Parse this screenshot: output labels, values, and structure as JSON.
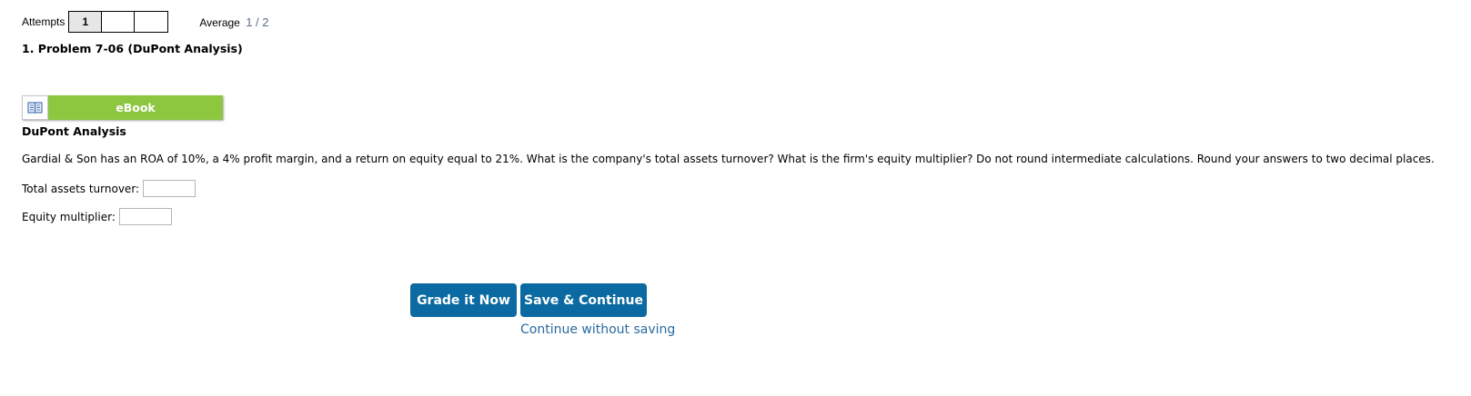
{
  "attempts": {
    "label": "Attempts",
    "boxes": [
      "1",
      "",
      ""
    ]
  },
  "average": {
    "label": "Average",
    "value": "1 / 2"
  },
  "problem": {
    "title": "1.  Problem 7-06 (DuPont Analysis)"
  },
  "ebook": {
    "label": "eBook",
    "icon": "book-icon"
  },
  "section": {
    "heading": "DuPont Analysis",
    "text": "Gardial & Son has an ROA of 10%, a 4% profit margin, and a return on equity equal to 21%. What is the company's total assets turnover? What is the firm's equity multiplier? Do not round intermediate calculations. Round your answers to two decimal places."
  },
  "fields": {
    "total_assets_turnover": {
      "label": "Total assets turnover:",
      "value": ""
    },
    "equity_multiplier": {
      "label": "Equity multiplier:",
      "value": ""
    }
  },
  "actions": {
    "grade_label": "Grade it Now",
    "save_label": "Save & Continue",
    "continue_label": "Continue without saving"
  },
  "colors": {
    "ebook_green": "#8dc63f",
    "button_blue": "#0a6aa1",
    "link_blue": "#2b6aa0"
  }
}
